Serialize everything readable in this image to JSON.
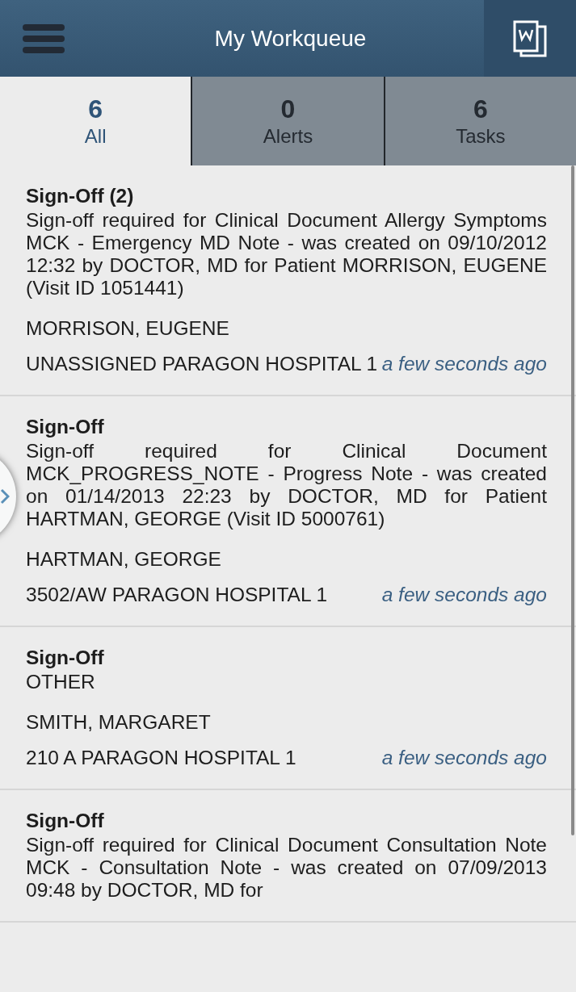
{
  "header": {
    "title": "My Workqueue"
  },
  "tabs": [
    {
      "count": "6",
      "label": "All",
      "selected": true
    },
    {
      "count": "0",
      "label": "Alerts",
      "selected": false
    },
    {
      "count": "6",
      "label": "Tasks",
      "selected": false
    }
  ],
  "items": [
    {
      "title": "Sign-Off (2)",
      "description": "Sign-off required for Clinical Document Allergy Symptoms MCK - Emergency MD Note - was created on 09/10/2012 12:32 by DOCTOR, MD for Patient MORRISON, EUGENE (Visit ID 1051441)",
      "patient": "MORRISON, EUGENE",
      "location": "UNASSIGNED PARAGON HOSPITAL 1",
      "time": "a few seconds ago"
    },
    {
      "title": "Sign-Off",
      "description": "Sign-off required for Clinical Document MCK_PROGRESS_NOTE - Progress Note - was created on 01/14/2013 22:23 by DOCTOR, MD for Patient HARTMAN, GEORGE (Visit ID 5000761)",
      "patient": "HARTMAN, GEORGE",
      "location": "3502/AW PARAGON HOSPITAL 1",
      "time": "a few seconds ago"
    },
    {
      "title": "Sign-Off",
      "description": "OTHER",
      "patient": "SMITH, MARGARET",
      "location": "210 A PARAGON HOSPITAL 1",
      "time": "a few seconds ago"
    },
    {
      "title": "Sign-Off",
      "description": "Sign-off required for Clinical Document Consultation Note MCK - Consultation Note - was created on 07/09/2013 09:48 by DOCTOR, MD for"
    }
  ]
}
